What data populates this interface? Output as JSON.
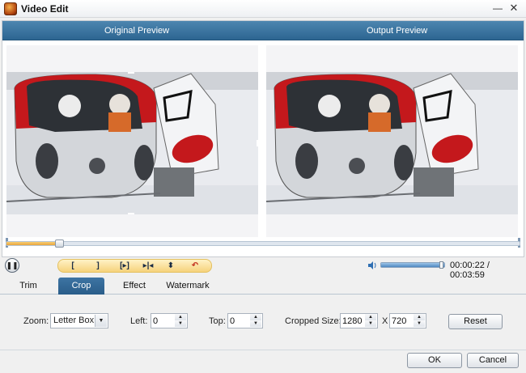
{
  "window": {
    "title": "Video Edit",
    "minimize_glyph": "—",
    "close_glyph": "✕"
  },
  "preview": {
    "original_label": "Original Preview",
    "output_label": "Output Preview"
  },
  "playback": {
    "pause_glyph": "❚❚",
    "seek_progress": 0.095,
    "tools": [
      {
        "name": "mark-in-icon",
        "glyph": "["
      },
      {
        "name": "mark-out-icon",
        "glyph": "]"
      },
      {
        "name": "play-segment-icon",
        "glyph": "[▸]"
      },
      {
        "name": "next-segment-icon",
        "glyph": "▸|◂"
      },
      {
        "name": "split-icon",
        "glyph": "⬍"
      },
      {
        "name": "undo-icon",
        "glyph": "↶"
      }
    ],
    "volume": 1.0,
    "time": "00:00:22 / 00:03:59"
  },
  "tabs": [
    {
      "label": "Trim",
      "active": false
    },
    {
      "label": "Crop",
      "active": true
    },
    {
      "label": "Effect",
      "active": false
    },
    {
      "label": "Watermark",
      "active": false
    }
  ],
  "crop": {
    "zoom_label": "Zoom:",
    "zoom_value": "Letter Box",
    "left_label": "Left:",
    "left_value": "0",
    "top_label": "Top:",
    "top_value": "0",
    "cropped_size_label": "Cropped Size:",
    "width_value": "1280",
    "x_label": "X",
    "height_value": "720",
    "reset_label": "Reset"
  },
  "footer": {
    "ok_label": "OK",
    "cancel_label": "Cancel"
  },
  "colors": {
    "header_blue": "#2d6591",
    "accent_yellow": "#f6d27c",
    "helicopter_red": "#c4181c"
  },
  "icons": [
    "app-icon",
    "pause-icon",
    "speaker-icon",
    "chevron-down-icon",
    "spinner-up-icon",
    "spinner-down-icon"
  ]
}
